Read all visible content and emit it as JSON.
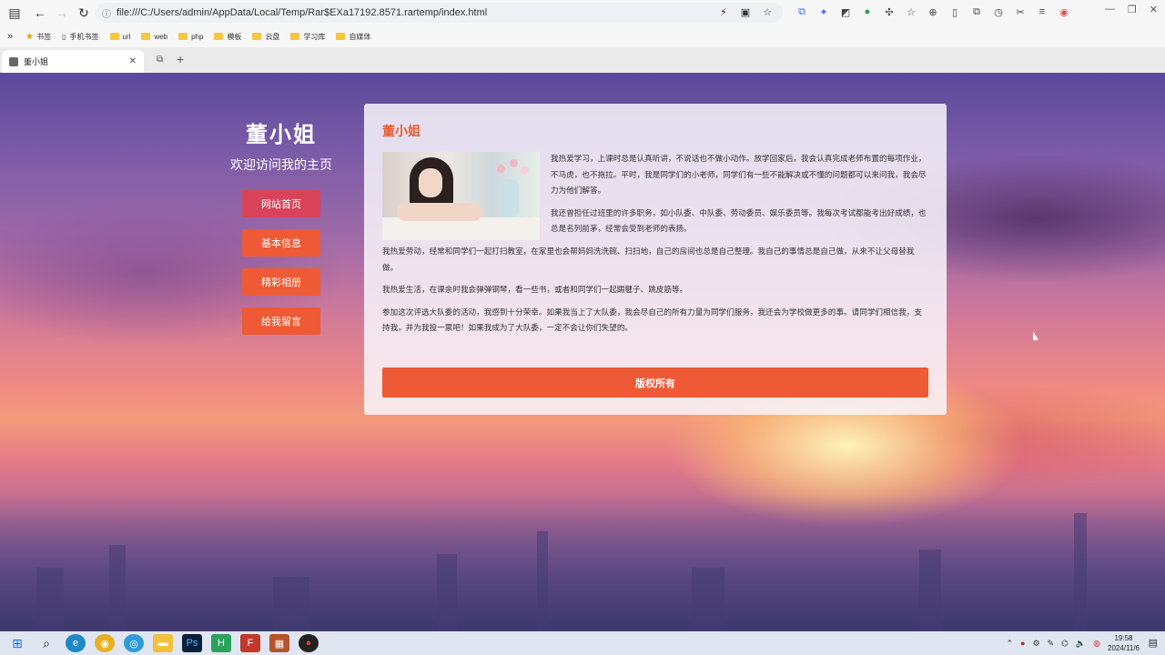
{
  "browser": {
    "url": "file:///C:/Users/admin/AppData/Local/Temp/Rar$EXa17192.8571.rartemp/index.html",
    "bookmarks": [
      "书签",
      "手机书签",
      "url",
      "web",
      "php",
      "模板",
      "云盘",
      "学习库",
      "自媒体"
    ],
    "tab_title": "董小姐"
  },
  "sidebar": {
    "title": "董小姐",
    "welcome": "欢迎访问我的主页",
    "menu": [
      "网站首页",
      "基本信息",
      "精彩相册",
      "给我留言"
    ]
  },
  "card": {
    "title": "董小姐",
    "paragraphs": [
      "我热爱学习，上课时总是认真听讲，不说话也不做小动作。放学回家后，我会认真完成老师布置的每项作业，不马虎，也不拖拉。平时，我是同学们的小老师，同学们有一些不能解决或不懂的问题都可以来问我，我会尽力为他们解答。",
      "我还曾担任过班里的许多职务，如小队委、中队委、劳动委员、娱乐委员等。我每次考试都能考出好成绩，也总是名列前茅，经常会受到老师的表扬。",
      "我热爱劳动，经常和同学们一起打扫教室，在家里也会帮妈妈洗洗碗、扫扫地，自己的房间也总是自己整理。我自己的事情总是自己做，从来不让父母替我做。",
      "我热爱生活，在课余时我会弹弹钢琴，看一些书，或者和同学们一起踢毽子、跳皮筋等。",
      "参加这次评选大队委的活动，我感到十分荣幸。如果我当上了大队委，我会尽自己的所有力量为同学们服务，我还会为学校做更多的事。请同学们相信我，支持我，并为我投一票吧！如果我成为了大队委，一定不会让你们失望的。"
    ],
    "footer": "版权所有"
  },
  "taskbar": {
    "time": "19:58",
    "date": "2024/11/6"
  },
  "colors": {
    "accent": "#ee5a35",
    "accent_active": "#d9435a",
    "card_title": "#ea5a2e"
  }
}
